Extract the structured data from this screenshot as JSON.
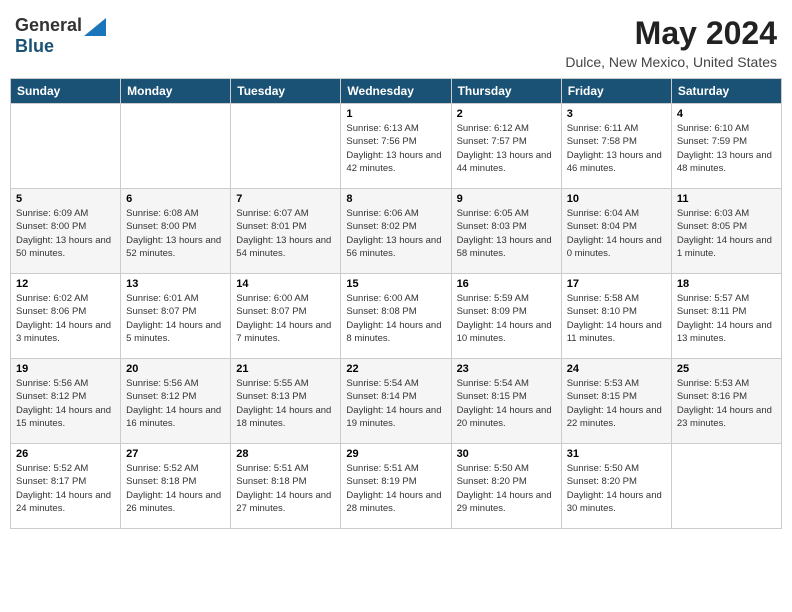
{
  "header": {
    "logo_general": "General",
    "logo_blue": "Blue",
    "month_title": "May 2024",
    "location": "Dulce, New Mexico, United States"
  },
  "days_of_week": [
    "Sunday",
    "Monday",
    "Tuesday",
    "Wednesday",
    "Thursday",
    "Friday",
    "Saturday"
  ],
  "weeks": [
    [
      {
        "day": "",
        "info": ""
      },
      {
        "day": "",
        "info": ""
      },
      {
        "day": "",
        "info": ""
      },
      {
        "day": "1",
        "info": "Sunrise: 6:13 AM\nSunset: 7:56 PM\nDaylight: 13 hours and 42 minutes."
      },
      {
        "day": "2",
        "info": "Sunrise: 6:12 AM\nSunset: 7:57 PM\nDaylight: 13 hours and 44 minutes."
      },
      {
        "day": "3",
        "info": "Sunrise: 6:11 AM\nSunset: 7:58 PM\nDaylight: 13 hours and 46 minutes."
      },
      {
        "day": "4",
        "info": "Sunrise: 6:10 AM\nSunset: 7:59 PM\nDaylight: 13 hours and 48 minutes."
      }
    ],
    [
      {
        "day": "5",
        "info": "Sunrise: 6:09 AM\nSunset: 8:00 PM\nDaylight: 13 hours and 50 minutes."
      },
      {
        "day": "6",
        "info": "Sunrise: 6:08 AM\nSunset: 8:00 PM\nDaylight: 13 hours and 52 minutes."
      },
      {
        "day": "7",
        "info": "Sunrise: 6:07 AM\nSunset: 8:01 PM\nDaylight: 13 hours and 54 minutes."
      },
      {
        "day": "8",
        "info": "Sunrise: 6:06 AM\nSunset: 8:02 PM\nDaylight: 13 hours and 56 minutes."
      },
      {
        "day": "9",
        "info": "Sunrise: 6:05 AM\nSunset: 8:03 PM\nDaylight: 13 hours and 58 minutes."
      },
      {
        "day": "10",
        "info": "Sunrise: 6:04 AM\nSunset: 8:04 PM\nDaylight: 14 hours and 0 minutes."
      },
      {
        "day": "11",
        "info": "Sunrise: 6:03 AM\nSunset: 8:05 PM\nDaylight: 14 hours and 1 minute."
      }
    ],
    [
      {
        "day": "12",
        "info": "Sunrise: 6:02 AM\nSunset: 8:06 PM\nDaylight: 14 hours and 3 minutes."
      },
      {
        "day": "13",
        "info": "Sunrise: 6:01 AM\nSunset: 8:07 PM\nDaylight: 14 hours and 5 minutes."
      },
      {
        "day": "14",
        "info": "Sunrise: 6:00 AM\nSunset: 8:07 PM\nDaylight: 14 hours and 7 minutes."
      },
      {
        "day": "15",
        "info": "Sunrise: 6:00 AM\nSunset: 8:08 PM\nDaylight: 14 hours and 8 minutes."
      },
      {
        "day": "16",
        "info": "Sunrise: 5:59 AM\nSunset: 8:09 PM\nDaylight: 14 hours and 10 minutes."
      },
      {
        "day": "17",
        "info": "Sunrise: 5:58 AM\nSunset: 8:10 PM\nDaylight: 14 hours and 11 minutes."
      },
      {
        "day": "18",
        "info": "Sunrise: 5:57 AM\nSunset: 8:11 PM\nDaylight: 14 hours and 13 minutes."
      }
    ],
    [
      {
        "day": "19",
        "info": "Sunrise: 5:56 AM\nSunset: 8:12 PM\nDaylight: 14 hours and 15 minutes."
      },
      {
        "day": "20",
        "info": "Sunrise: 5:56 AM\nSunset: 8:12 PM\nDaylight: 14 hours and 16 minutes."
      },
      {
        "day": "21",
        "info": "Sunrise: 5:55 AM\nSunset: 8:13 PM\nDaylight: 14 hours and 18 minutes."
      },
      {
        "day": "22",
        "info": "Sunrise: 5:54 AM\nSunset: 8:14 PM\nDaylight: 14 hours and 19 minutes."
      },
      {
        "day": "23",
        "info": "Sunrise: 5:54 AM\nSunset: 8:15 PM\nDaylight: 14 hours and 20 minutes."
      },
      {
        "day": "24",
        "info": "Sunrise: 5:53 AM\nSunset: 8:15 PM\nDaylight: 14 hours and 22 minutes."
      },
      {
        "day": "25",
        "info": "Sunrise: 5:53 AM\nSunset: 8:16 PM\nDaylight: 14 hours and 23 minutes."
      }
    ],
    [
      {
        "day": "26",
        "info": "Sunrise: 5:52 AM\nSunset: 8:17 PM\nDaylight: 14 hours and 24 minutes."
      },
      {
        "day": "27",
        "info": "Sunrise: 5:52 AM\nSunset: 8:18 PM\nDaylight: 14 hours and 26 minutes."
      },
      {
        "day": "28",
        "info": "Sunrise: 5:51 AM\nSunset: 8:18 PM\nDaylight: 14 hours and 27 minutes."
      },
      {
        "day": "29",
        "info": "Sunrise: 5:51 AM\nSunset: 8:19 PM\nDaylight: 14 hours and 28 minutes."
      },
      {
        "day": "30",
        "info": "Sunrise: 5:50 AM\nSunset: 8:20 PM\nDaylight: 14 hours and 29 minutes."
      },
      {
        "day": "31",
        "info": "Sunrise: 5:50 AM\nSunset: 8:20 PM\nDaylight: 14 hours and 30 minutes."
      },
      {
        "day": "",
        "info": ""
      }
    ]
  ]
}
